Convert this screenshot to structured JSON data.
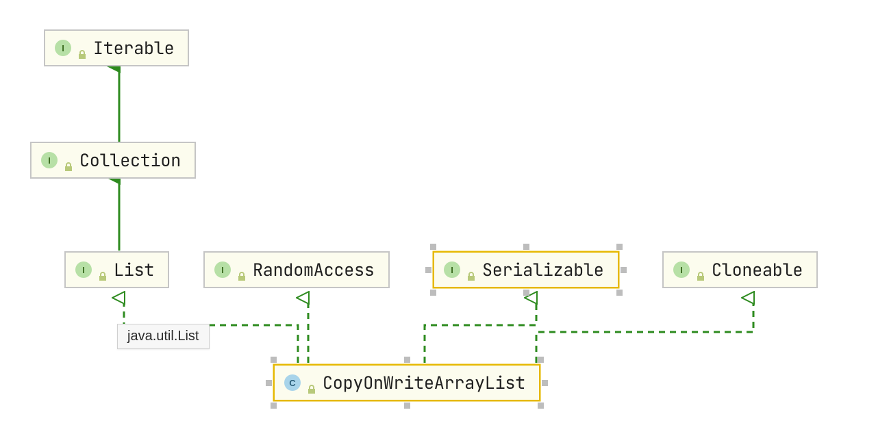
{
  "colors": {
    "node_fill": "#fcfcee",
    "node_border": "#c5c5c5",
    "selected_border": "#e6b800",
    "arrow_solid": "#2e8b1f",
    "arrow_dashed": "#2e8b1f",
    "interface_badge_bg": "#b7e0a6",
    "class_badge_bg": "#a8d4ea",
    "lock_color": "#b8c97a"
  },
  "tooltip": {
    "text": "java.util.List"
  },
  "nodes": {
    "iterable": {
      "kind": "interface",
      "kind_letter": "I",
      "label": "Iterable",
      "selected": false
    },
    "collection": {
      "kind": "interface",
      "kind_letter": "I",
      "label": "Collection",
      "selected": false
    },
    "list": {
      "kind": "interface",
      "kind_letter": "I",
      "label": "List",
      "selected": false
    },
    "random_access": {
      "kind": "interface",
      "kind_letter": "I",
      "label": "RandomAccess",
      "selected": false
    },
    "serializable": {
      "kind": "interface",
      "kind_letter": "I",
      "label": "Serializable",
      "selected": true
    },
    "cloneable": {
      "kind": "interface",
      "kind_letter": "I",
      "label": "Cloneable",
      "selected": false
    },
    "cowal": {
      "kind": "class",
      "kind_letter": "C",
      "label": "CopyOnWriteArrayList",
      "selected": true
    }
  },
  "edges": [
    {
      "from": "collection",
      "to": "iterable",
      "style": "solid"
    },
    {
      "from": "list",
      "to": "collection",
      "style": "solid"
    },
    {
      "from": "cowal",
      "to": "list",
      "style": "dashed"
    },
    {
      "from": "cowal",
      "to": "random_access",
      "style": "dashed"
    },
    {
      "from": "cowal",
      "to": "serializable",
      "style": "dashed"
    },
    {
      "from": "cowal",
      "to": "cloneable",
      "style": "dashed"
    }
  ]
}
